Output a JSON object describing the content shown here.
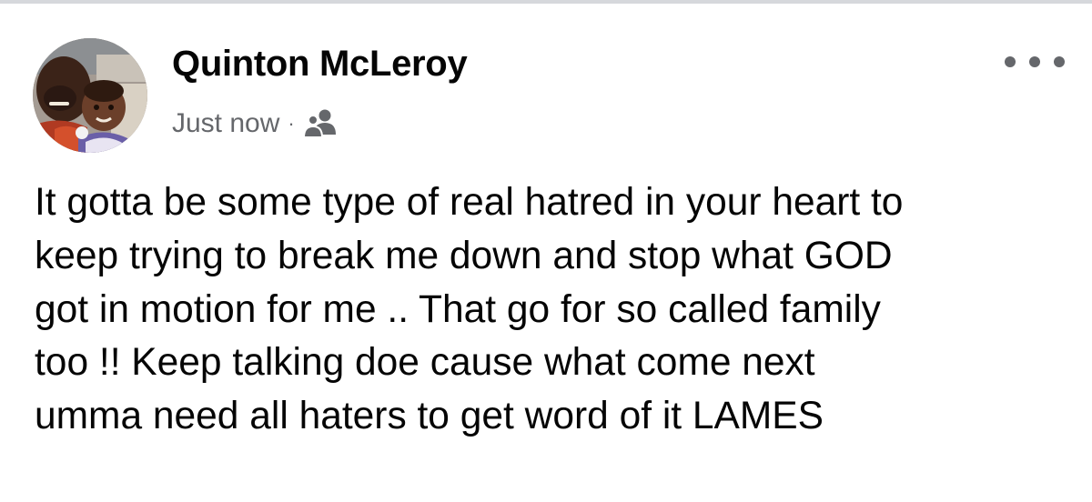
{
  "post": {
    "author_name": "Quinton McLeroy",
    "timestamp": "Just now",
    "meta_separator": "·",
    "audience_icon": "friends-icon",
    "more_icon": "more-options-icon",
    "text_lines": [
      "It gotta be some type of real hatred in your heart to",
      "keep trying to break me down and stop what GOD",
      "got in motion for me .. That go for so called family",
      "too !! Keep talking doe cause what come next",
      "umma need all haters to get word of it LAMES"
    ]
  },
  "colors": {
    "primary_text": "#050505",
    "secondary_text": "#65676b",
    "background": "#ffffff",
    "divider": "#d6d8dc"
  }
}
